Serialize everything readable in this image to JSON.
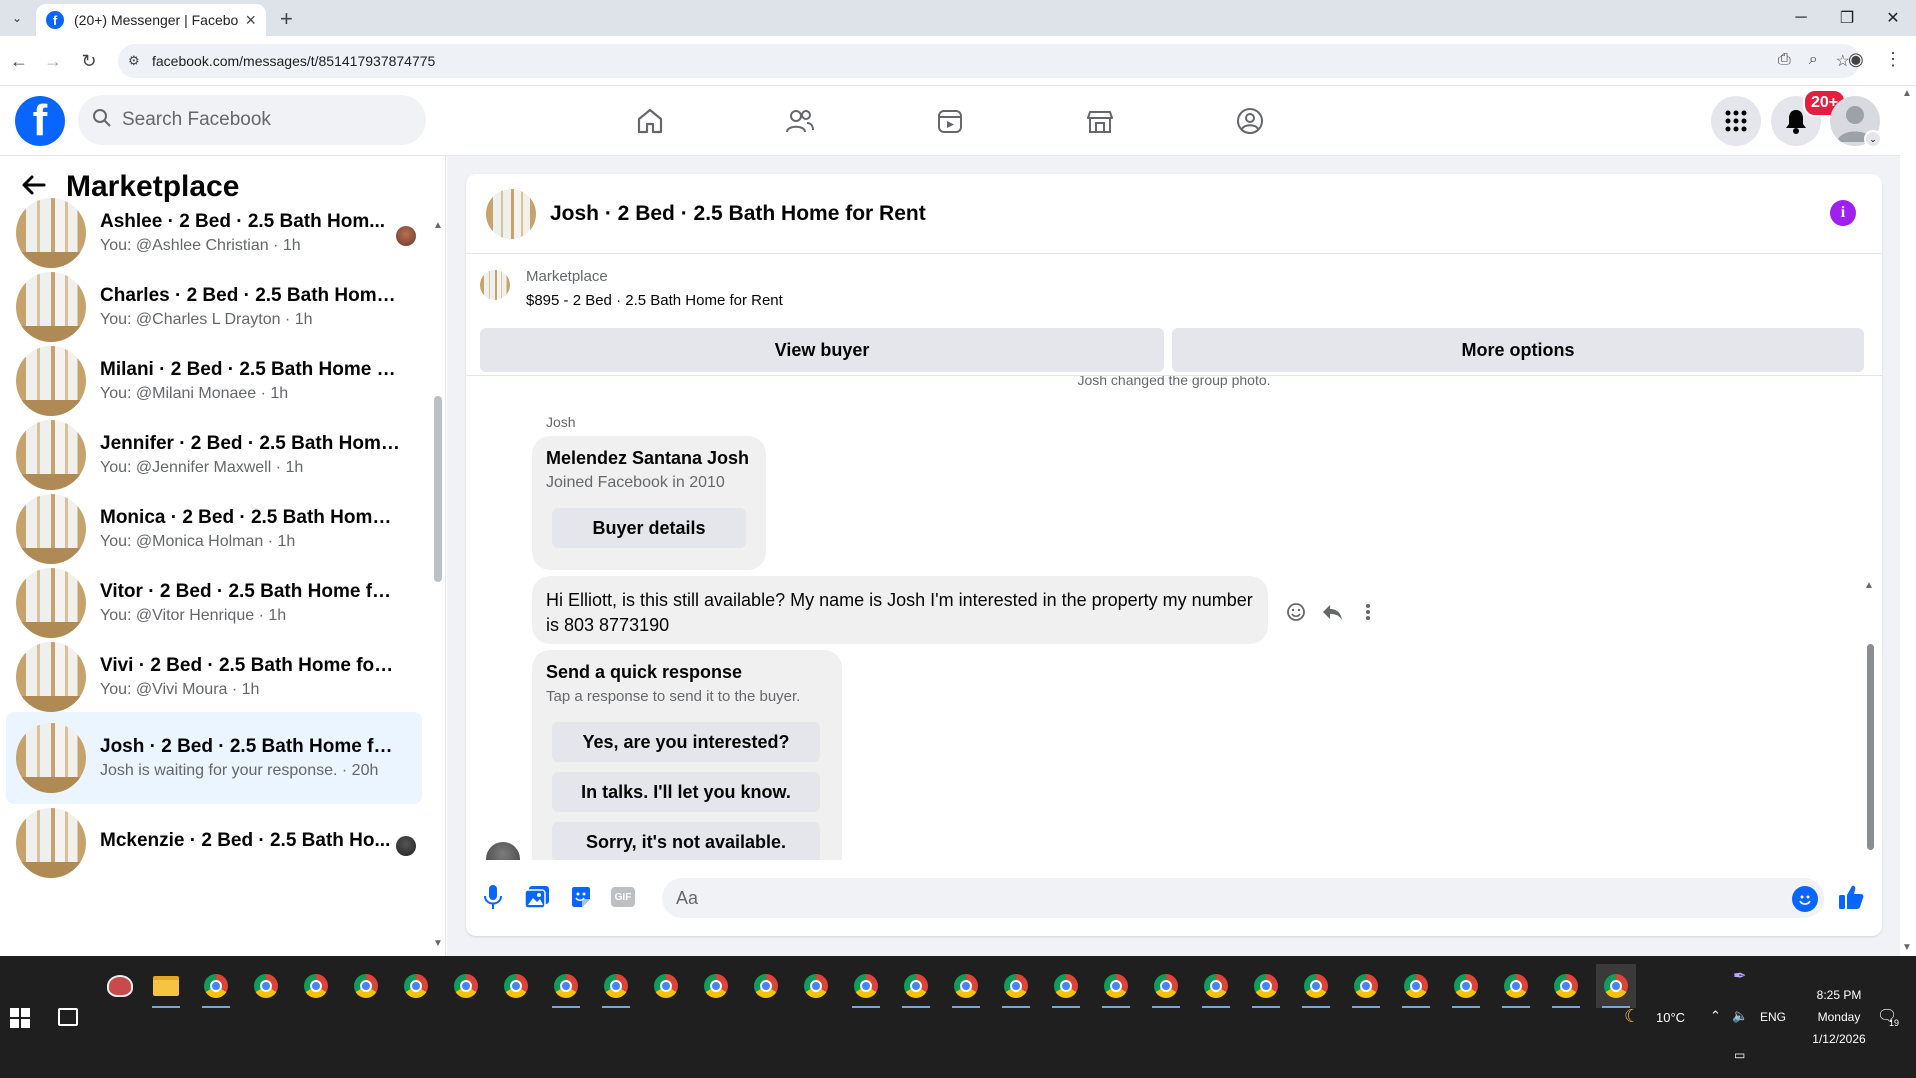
{
  "browser": {
    "tab_title": "(20+) Messenger | Facebook",
    "url": "facebook.com/messages/t/851417937874775"
  },
  "facebook": {
    "search_placeholder": "Search Facebook",
    "notification_count": "20+",
    "accent_color": "#0866ff"
  },
  "sidebar": {
    "title": "Marketplace",
    "conversations": [
      {
        "name": "Ashlee · 2 Bed · 2.5 Bath Hom...",
        "subtitle": "You: @Ashlee Christian · 1h",
        "active": false
      },
      {
        "name": "Charles · 2 Bed · 2.5 Bath Home f...",
        "subtitle": "You: @Charles L Drayton · 1h",
        "active": false
      },
      {
        "name": "Milani · 2 Bed · 2.5 Bath Home fo...",
        "subtitle": "You: @Milani Monaee · 1h",
        "active": false
      },
      {
        "name": "Jennifer · 2 Bed · 2.5 Bath Home ...",
        "subtitle": "You: @Jennifer Maxwell · 1h",
        "active": false
      },
      {
        "name": "Monica · 2 Bed · 2.5 Bath Home f...",
        "subtitle": "You: @Monica Holman · 1h",
        "active": false
      },
      {
        "name": "Vitor · 2 Bed · 2.5 Bath Home for...",
        "subtitle": "You: @Vitor Henrique · 1h",
        "active": false
      },
      {
        "name": "Vivi · 2 Bed · 2.5 Bath Home for ...",
        "subtitle": "You: @Vivi Moura · 1h",
        "active": false
      },
      {
        "name": "Josh · 2 Bed · 2.5 Bath Home for ...",
        "subtitle": "Josh is waiting for your response. · 20h",
        "active": true
      },
      {
        "name": "Mckenzie · 2 Bed · 2.5 Bath Ho...",
        "subtitle": "",
        "active": false
      }
    ]
  },
  "chat": {
    "title": "Josh · 2 Bed · 2.5 Bath Home for Rent",
    "listing": {
      "label": "Marketplace",
      "description": "$895 - 2 Bed · 2.5 Bath Home for Rent",
      "view_buyer_label": "View buyer",
      "more_options_label": "More options"
    },
    "system_message": "Josh changed the group photo.",
    "sender": "Josh",
    "profile_card": {
      "name": "Melendez Santana Josh",
      "subtitle": "Joined Facebook in 2010",
      "button_label": "Buyer details"
    },
    "message": "Hi Elliott, is this still available? My name is Josh I'm interested in the property my number is 803 8773190",
    "quick_response": {
      "title": "Send a quick response",
      "subtitle": "Tap a response to send it to the buyer.",
      "options": [
        "Yes, are you interested?",
        "In talks. I'll let you know.",
        "Sorry, it's not available."
      ]
    },
    "composer": {
      "placeholder": "Aa",
      "gif_label": "GIF"
    }
  },
  "taskbar": {
    "weather": "10°C",
    "language": "ENG",
    "time": "8:25 PM",
    "day": "Monday",
    "date": "1/12/2026",
    "notification_count": "19"
  }
}
